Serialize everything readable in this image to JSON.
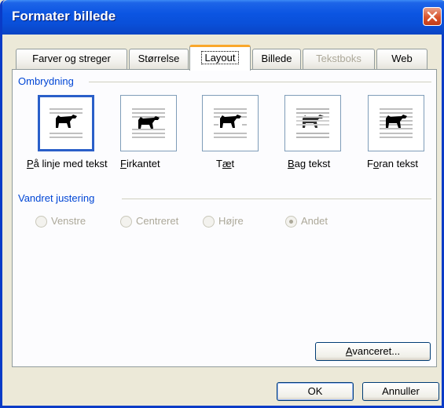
{
  "dialog": {
    "title": "Formater billede"
  },
  "tabs": [
    {
      "label": "Farver og streger",
      "state": "normal"
    },
    {
      "label": "Størrelse",
      "state": "normal"
    },
    {
      "label": "Layout",
      "state": "active"
    },
    {
      "label": "Billede",
      "state": "normal"
    },
    {
      "label": "Tekstboks",
      "state": "disabled"
    },
    {
      "label": "Web",
      "state": "normal"
    }
  ],
  "wrapping": {
    "group_label": "Ombrydning",
    "options": [
      {
        "label_accel": "P",
        "label_rest": "å linje med tekst",
        "icon": "in-line-with-text-icon",
        "selected": true
      },
      {
        "label_accel": "F",
        "label_rest": "irkantet",
        "icon": "square-wrap-icon",
        "selected": false
      },
      {
        "label_pre": "T",
        "label_accel": "æ",
        "label_rest": "t",
        "icon": "tight-wrap-icon",
        "selected": false
      },
      {
        "label_accel": "B",
        "label_rest": "ag tekst",
        "icon": "behind-text-icon",
        "selected": false
      },
      {
        "label_pre": "F",
        "label_accel": "o",
        "label_rest": "ran tekst",
        "icon": "in-front-of-text-icon",
        "selected": false
      }
    ]
  },
  "alignment": {
    "group_label": "Vandret justering",
    "options": [
      {
        "label": "Venstre",
        "checked": false,
        "enabled": false
      },
      {
        "label": "Centreret",
        "checked": false,
        "enabled": false
      },
      {
        "label": "Højre",
        "checked": false,
        "enabled": false
      },
      {
        "label": "Andet",
        "checked": true,
        "enabled": false
      }
    ]
  },
  "buttons": {
    "advanced_accel": "A",
    "advanced_rest": "vanceret...",
    "ok": "OK",
    "cancel": "Annuller"
  },
  "colors": {
    "titlebar": "#0a4fd8",
    "group_label": "#0046d5",
    "active_tab_accent": "#f9a72b",
    "close_button": "#d9532c",
    "disabled_text": "#aca899"
  }
}
